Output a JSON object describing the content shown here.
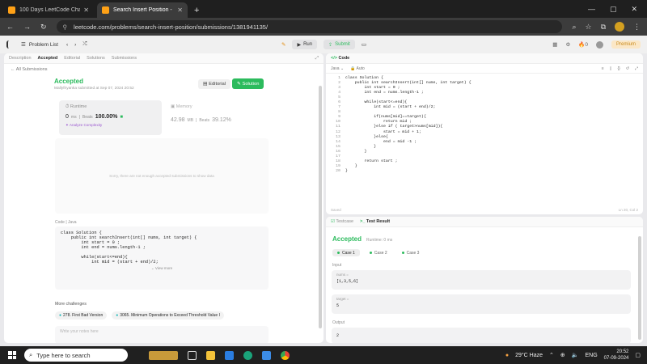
{
  "browser": {
    "tabs": [
      {
        "title": "100 Days LeetCode Challenge",
        "active": false
      },
      {
        "title": "Search Insert Position - LeetCo",
        "active": true
      }
    ],
    "url": "leetcode.com/problems/search-insert-position/submissions/1381941135/"
  },
  "topbar": {
    "problem_list": "Problem List",
    "run": "Run",
    "submit": "Submit",
    "streak": "0",
    "premium": "Premium"
  },
  "left": {
    "tabs": [
      "Description",
      "Accepted",
      "Editorial",
      "Solutions",
      "Submissions"
    ],
    "all_submissions": "All Submissions",
    "status": "Accepted",
    "meta": "Mallyfriyanka submitted at Sep 07, 2024 20:52",
    "editorial_btn": "Editorial",
    "solution_btn": "Solution",
    "runtime_label": "Runtime",
    "runtime_value": "0",
    "runtime_unit": "ms",
    "beats_label": "Beats",
    "beats_value": "100.00%",
    "memory_label": "Memory",
    "memory_value": "42.98",
    "memory_unit": "MB",
    "memory_beats_label": "Beats",
    "memory_beats_value": "39.12%",
    "analyze": "Analyze Complexity",
    "empty_text": "Sorry, there are not enough accepted submissions to show data",
    "code_label": "Code",
    "code_lang": "Java",
    "code_lines": [
      "class Solution {",
      "    public int searchInsert(int[] nums, int target) {",
      "        int start = 0 ;",
      "        int end = nums.length-1 ;",
      "",
      "        while(start<=end){",
      "            int mid = (start + end)/2;"
    ],
    "view_more": "View more",
    "more_challenges": "More challenges",
    "challenges": [
      "278. First Bad Version",
      "3065. Minimum Operations to Exceed Threshold Value I"
    ],
    "notes_placeholder": "Write your notes here"
  },
  "editor": {
    "tab": "Code",
    "lang": "Java",
    "auto": "Auto",
    "lines": [
      "class Solution {",
      "    public int searchInsert(int[] nums, int target) {",
      "        int start = 0 ;",
      "        int end = nums.length-1 ;",
      "",
      "        while(start<=end){",
      "            int mid = (start + end)/2;",
      "",
      "            if(nums[mid]==target){",
      "                return mid ;",
      "            }else if ( target>nums[mid]){",
      "                start = mid + 1;",
      "            }else{",
      "                end = mid -1 ;",
      "            }",
      "        }",
      "",
      "        return start ;",
      "    }",
      "}"
    ],
    "saved": "Saved",
    "cursor": "Ln 20, Col 2"
  },
  "bottom": {
    "testcase_tab": "Testcase",
    "result_tab": "Test Result",
    "status": "Accepted",
    "runtime": "Runtime: 0 ms",
    "cases": [
      "Case 1",
      "Case 2",
      "Case 3"
    ],
    "input_label": "Input",
    "nums_label": "nums =",
    "nums_value": "[1,3,5,6]",
    "target_label": "target =",
    "target_value": "5",
    "output_label": "Output",
    "output_value": "2"
  },
  "taskbar": {
    "search_placeholder": "Type here to search",
    "weather": "29°C  Haze",
    "lang": "ENG",
    "time": "20:52",
    "date": "07-09-2024"
  }
}
